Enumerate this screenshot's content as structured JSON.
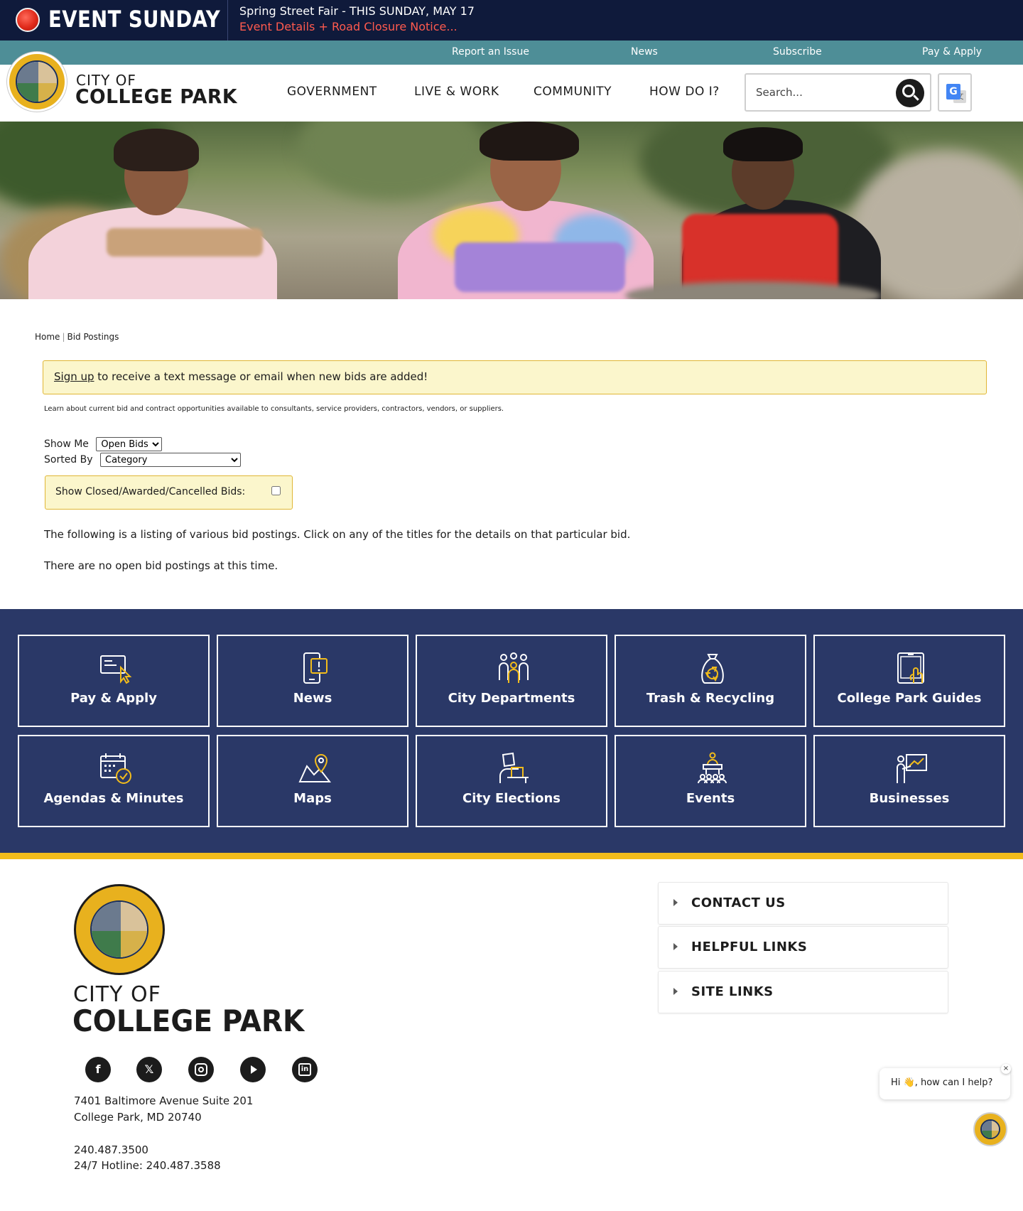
{
  "event": {
    "title": "EVENT SUNDAY",
    "headline": "Spring Street Fair - THIS SUNDAY, MAY 17",
    "link": "Event Details + Road Closure Notice..."
  },
  "utility": [
    "Report an Issue",
    "News",
    "Subscribe",
    "Pay & Apply"
  ],
  "brand": {
    "city_of": "CITY OF",
    "name": "COLLEGE PARK"
  },
  "nav": [
    "GOVERNMENT",
    "LIVE & WORK",
    "COMMUNITY",
    "HOW DO I?"
  ],
  "search": {
    "placeholder": "Search..."
  },
  "translate": {
    "g": "G",
    "a": "文"
  },
  "breadcrumb": {
    "home": "Home",
    "separator": "|",
    "current": "Bid Postings"
  },
  "notice": {
    "link": "Sign up",
    "text": " to receive a text message or email when new bids are added!"
  },
  "intro": "Learn about current bid and contract opportunities available to consultants, service providers, contractors, vendors, or suppliers.",
  "filters": {
    "show_me_label": "Show Me",
    "show_me_value": "Open Bids",
    "sorted_by_label": "Sorted By",
    "sorted_by_value": "Category",
    "closed_label": "Show Closed/Awarded/Cancelled Bids:"
  },
  "listing_text": "The following is a listing of various bid postings. Click on any of the titles for the details on that particular bid.",
  "empty_text": "There are no open bid postings at this time.",
  "quick_links": [
    {
      "label": "Pay & Apply",
      "icon": "pay-apply-icon"
    },
    {
      "label": "News",
      "icon": "news-icon"
    },
    {
      "label": "City Departments",
      "icon": "city-departments-icon"
    },
    {
      "label": "Trash & Recycling",
      "icon": "trash-recycling-icon"
    },
    {
      "label": "College Park Guides",
      "icon": "guides-icon"
    },
    {
      "label": "Agendas & Minutes",
      "icon": "agendas-icon"
    },
    {
      "label": "Maps",
      "icon": "maps-icon"
    },
    {
      "label": "City Elections",
      "icon": "elections-icon"
    },
    {
      "label": "Events",
      "icon": "events-icon"
    },
    {
      "label": "Businesses",
      "icon": "businesses-icon"
    }
  ],
  "footer": {
    "city_of": "CITY OF",
    "name": "COLLEGE PARK",
    "social": [
      "facebook-icon",
      "x-icon",
      "instagram-icon",
      "youtube-icon",
      "linkedin-icon"
    ],
    "address1": "7401 Baltimore Avenue Suite 201",
    "address2": "College Park, MD 20740",
    "phone": "240.487.3500",
    "hotline": "24/7 Hotline: 240.487.3588",
    "accordions": [
      "CONTACT US",
      "HELPFUL LINKS",
      "SITE LINKS"
    ]
  },
  "chat": {
    "greeting": "Hi 👋, how can I help?",
    "close": "×"
  },
  "colors": {
    "event_bg": "#0f1a3b",
    "event_link": "#ff5a4e",
    "utility_bg": "#4e8e97",
    "quick_bg": "#2a3867",
    "accent_gold": "#f2bc1b",
    "notice_bg": "#fbf6cc"
  }
}
